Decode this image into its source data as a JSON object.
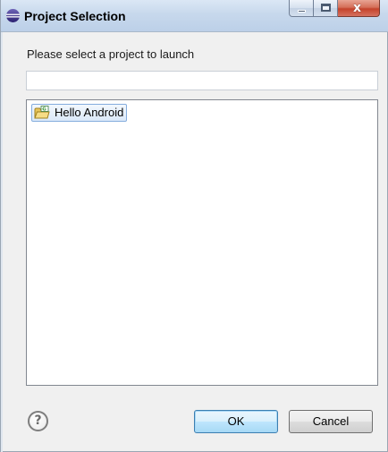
{
  "window": {
    "title": "Project Selection",
    "icon": "eclipse-icon"
  },
  "caption_buttons": {
    "minimize_icon": "minimize-icon",
    "maximize_icon": "maximize-icon",
    "close_glyph": "x"
  },
  "prompt": "Please select a project to launch",
  "filter": {
    "value": "",
    "placeholder": ""
  },
  "projects": [
    {
      "label": "Hello Android",
      "icon": "android-project-icon",
      "selected": true
    }
  ],
  "buttons": {
    "help_glyph": "?",
    "ok_label": "OK",
    "cancel_label": "Cancel"
  },
  "colors": {
    "titlebar": "#c7d8ec",
    "selection_border": "#84acdd",
    "close_button": "#c5432b",
    "default_button_border": "#3c7fb1"
  }
}
